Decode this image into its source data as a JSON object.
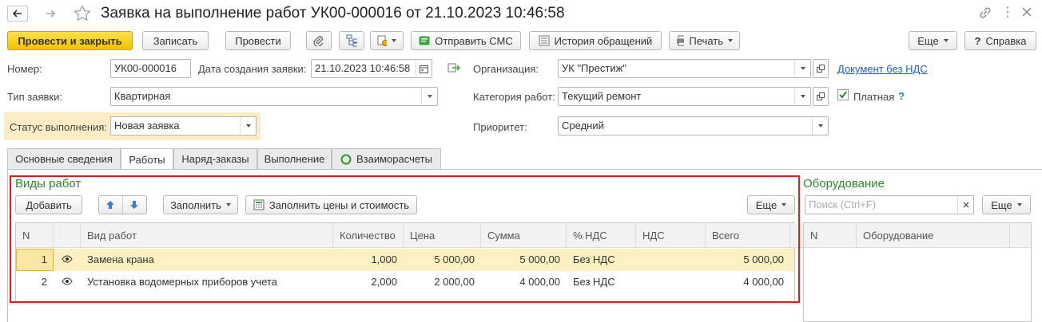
{
  "window": {
    "title": "Заявка на выполнение работ УК00-000016 от 21.10.2023 10:46:58"
  },
  "toolbar": {
    "post_close": "Провести и закрыть",
    "write": "Записать",
    "post": "Провести",
    "send_sms": "Отправить СМС",
    "history": "История обращений",
    "print": "Печать",
    "more": "Еще",
    "help": "Справка"
  },
  "form": {
    "number_label": "Номер:",
    "number_value": "УК00-000016",
    "created_label": "Дата создания заявки:",
    "created_value": "21.10.2023 10:46:58",
    "org_label": "Организация:",
    "org_value": "УК \"Престиж\"",
    "no_vat_link": "Документ без НДС",
    "type_label": "Тип заявки:",
    "type_value": "Квартирная",
    "category_label": "Категория работ:",
    "category_value": "Текущий ремонт",
    "paid_label": "Платная",
    "paid_help": "?",
    "status_label": "Статус выполнения:",
    "status_value": "Новая заявка",
    "priority_label": "Приоритет:",
    "priority_value": "Средний"
  },
  "tabs": [
    {
      "label": "Основные сведения"
    },
    {
      "label": "Работы"
    },
    {
      "label": "Наряд-заказы"
    },
    {
      "label": "Выполнение"
    },
    {
      "label": "Взаиморасчеты"
    }
  ],
  "works": {
    "title": "Виды работ",
    "add": "Добавить",
    "fill": "Заполнить",
    "fill_prices": "Заполнить цены и стоимость",
    "more": "Еще",
    "columns": [
      "N",
      "Вид работ",
      "Количество",
      "Цена",
      "Сумма",
      "% НДС",
      "НДС",
      "Всего"
    ],
    "rows": [
      {
        "n": "1",
        "name": "Замена крана",
        "qty": "1,000",
        "price": "5 000,00",
        "sum": "5 000,00",
        "vat_rate": "Без НДС",
        "vat": "",
        "total": "5 000,00"
      },
      {
        "n": "2",
        "name": "Установка водомерных приборов учета",
        "qty": "2,000",
        "price": "2 000,00",
        "sum": "4 000,00",
        "vat_rate": "Без НДС",
        "vat": "",
        "total": "4 000,00"
      }
    ]
  },
  "equipment": {
    "title": "Оборудование",
    "search_placeholder": "Поиск (Ctrl+F)",
    "more": "Еще",
    "columns": [
      "N",
      "Оборудование"
    ]
  },
  "colors": {
    "primary_button": "#f2c200",
    "section_title": "#2a8a2a",
    "highlight_border": "#e0201b",
    "selected_row": "#fdf1c4",
    "status_bg": "#fdecc4",
    "link": "#1f5eae"
  }
}
